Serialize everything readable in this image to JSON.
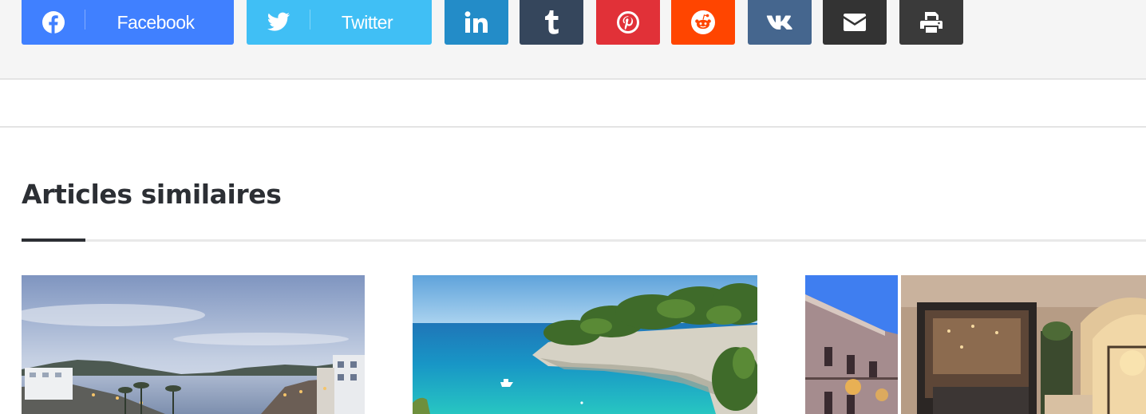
{
  "share": {
    "buttons": [
      {
        "id": "facebook",
        "label": "Facebook",
        "icon": "facebook-icon",
        "color": "#4080ff"
      },
      {
        "id": "twitter",
        "label": "Twitter",
        "icon": "twitter-icon",
        "color": "#40bff5"
      },
      {
        "id": "linkedin",
        "icon": "linkedin-icon",
        "color": "#238cc8"
      },
      {
        "id": "tumblr",
        "icon": "tumblr-icon",
        "color": "#35465c"
      },
      {
        "id": "pinterest",
        "icon": "pinterest-icon",
        "color": "#e13138"
      },
      {
        "id": "reddit",
        "icon": "reddit-icon",
        "color": "#ff4500"
      },
      {
        "id": "vk",
        "icon": "vk-icon",
        "color": "#45668e"
      },
      {
        "id": "email",
        "icon": "envelope-icon",
        "color": "#333333"
      },
      {
        "id": "print",
        "icon": "printer-icon",
        "color": "#3a3a3a"
      }
    ]
  },
  "related": {
    "title": "Articles similaires",
    "accent_color": "#2c2f34",
    "items": [
      {
        "image": "coastal-promenade-at-dusk"
      },
      {
        "image": "turquoise-cove-with-pine-cliffs"
      },
      {
        "image": "hotel-facade-and-lounge-interior"
      }
    ]
  }
}
